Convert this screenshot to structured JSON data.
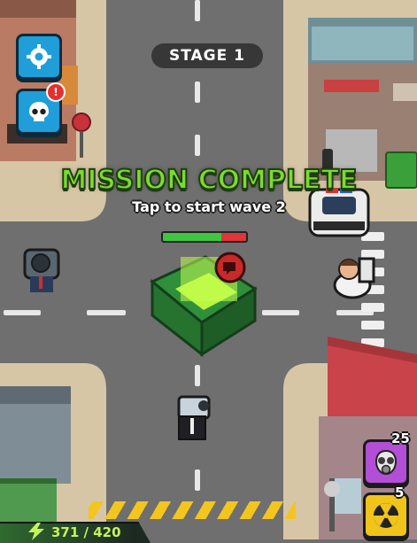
{
  "hud": {
    "stage_label": "STAGE 1",
    "mission_title": "MISSION COMPLETE",
    "mission_subtitle": "Tap to start wave 2",
    "boss_health_fraction": 0.7,
    "energy_text": "371 / 420",
    "energy_fraction": 0.88
  },
  "buttons": {
    "settings": {
      "icon": "gear-icon"
    },
    "skull": {
      "icon": "skull-icon",
      "badge": "!"
    }
  },
  "powers": [
    {
      "name": "gas-mask",
      "icon": "gas-mask-icon",
      "count": "25",
      "color": "#b24fd6"
    },
    {
      "name": "radiation",
      "icon": "radiation-icon",
      "count": "5",
      "color": "#f0c419"
    }
  ],
  "colors": {
    "mission_green": "#7bdc2f",
    "road": "#6e6e6e",
    "sidewalk": "#d9c8a8",
    "button_blue": "#1f9ed9",
    "hazard_yellow": "#f3c51f"
  }
}
